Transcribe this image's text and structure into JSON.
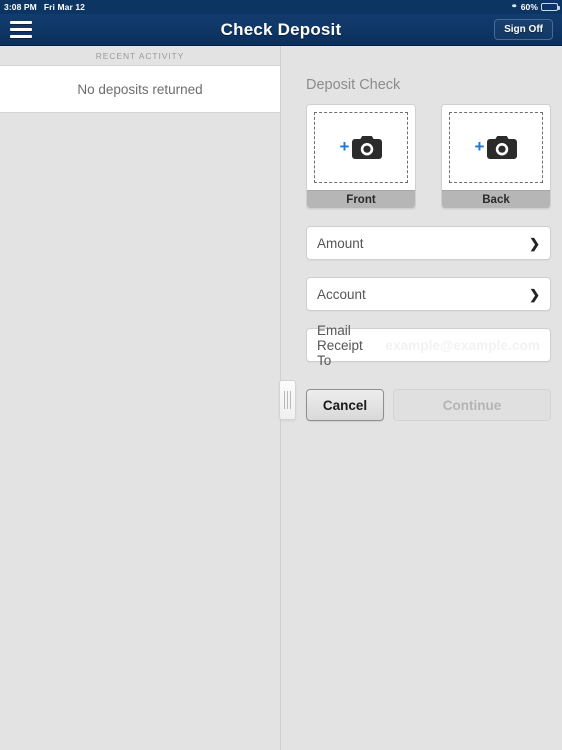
{
  "status_bar": {
    "time": "3:08 PM",
    "date": "Fri Mar 12",
    "battery_percent": "60%",
    "wifi_icon": "wifi-icon",
    "battery_icon": "battery-icon"
  },
  "nav_bar": {
    "menu_icon": "hamburger-menu-icon",
    "title": "Check Deposit",
    "sign_off_label": "Sign Off"
  },
  "left_panel": {
    "section_header": "RECENT ACTIVITY",
    "empty_state": "No deposits returned"
  },
  "right_panel": {
    "section_title": "Deposit Check",
    "capture_cards": [
      {
        "label": "Front",
        "plus": "+",
        "icon": "camera-icon"
      },
      {
        "label": "Back",
        "plus": "+",
        "icon": "camera-icon"
      }
    ],
    "fields": [
      {
        "label": "Amount",
        "chevron": "❯"
      },
      {
        "label": "Account",
        "chevron": "❯"
      }
    ],
    "email_field": {
      "label": "Email Receipt To",
      "placeholder": "example@example.com",
      "value": ""
    },
    "buttons": {
      "cancel": "Cancel",
      "continue": "Continue",
      "continue_disabled": true
    }
  },
  "colors": {
    "nav_blue": "#0f3665",
    "status_blue": "#0d3563",
    "accent_blue": "#1878d8",
    "panel_gray": "#e3e3e3",
    "label_gray": "#b6b6b6"
  }
}
